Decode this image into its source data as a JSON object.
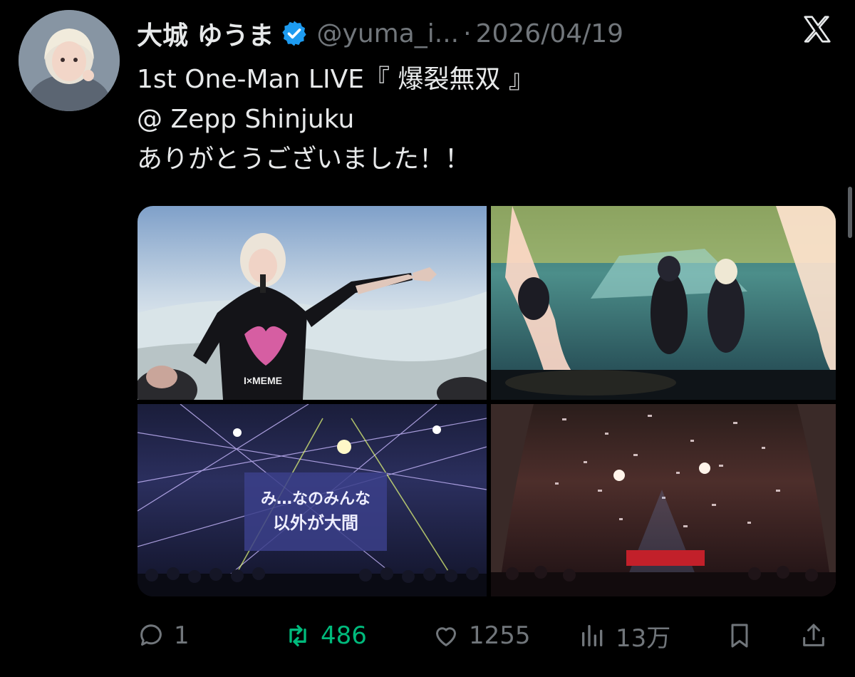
{
  "tweet": {
    "display_name": "大城 ゆうま",
    "handle": "@yuma_i...",
    "separator": "·",
    "date": "2026/04/19",
    "text_lines": [
      "1st One-Man LIVE『 爆裂無双 』",
      "@ Zepp Shinjuku",
      "ありがとうございました！！"
    ]
  },
  "media": {
    "shirt_text": "I×MEME",
    "screen_text_line1": "み…なのみんな",
    "screen_text_line2": "以外が大間"
  },
  "actions": {
    "reply_count": "1",
    "retweet_count": "486",
    "like_count": "1255",
    "views_count": "13万"
  },
  "icons": {
    "verified": "verified-badge-icon",
    "platform": "x-logo-icon",
    "reply": "reply-icon",
    "retweet": "retweet-icon",
    "like": "heart-icon",
    "views": "views-icon",
    "bookmark": "bookmark-icon",
    "share": "share-icon"
  },
  "colors": {
    "background": "#000000",
    "text_primary": "#e7e9ea",
    "text_secondary": "#71767b",
    "verified_blue": "#1d9bf0",
    "retweet_green": "#00ba7c"
  }
}
